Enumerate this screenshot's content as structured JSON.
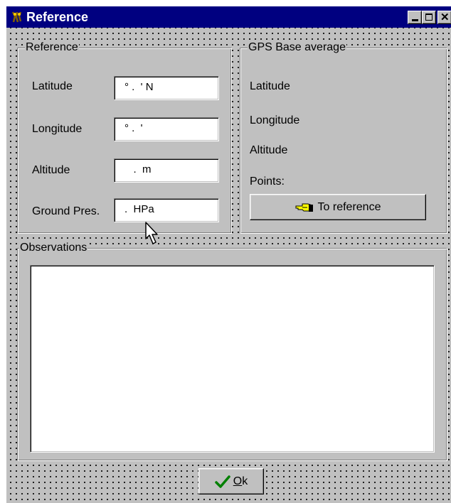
{
  "window": {
    "title": "Reference"
  },
  "reference": {
    "group_label": "Reference",
    "latitude": {
      "label": "Latitude",
      "value": "° .  ' N"
    },
    "longitude": {
      "label": "Longitude",
      "value": "° .  '"
    },
    "altitude": {
      "label": "Altitude",
      "value": "   .  m"
    },
    "ground_pres": {
      "label": "Ground Pres.",
      "value": ".  HPa"
    }
  },
  "gps_base": {
    "group_label": "GPS Base average",
    "latitude_label": "Latitude",
    "longitude_label": "Longitude",
    "altitude_label": "Altitude",
    "points_label": "Points:",
    "to_reference_button": "To reference",
    "button_icon": "pointing-hand-icon"
  },
  "observations": {
    "group_label": "Observations",
    "text": ""
  },
  "footer": {
    "ok_button_mnemonic": "O",
    "ok_button_rest": "k",
    "ok_icon": "checkmark-icon"
  },
  "colors": {
    "titlebar": "#000080",
    "face": "#c0c0c0",
    "check": "#008000",
    "hand": "#ffff00"
  }
}
